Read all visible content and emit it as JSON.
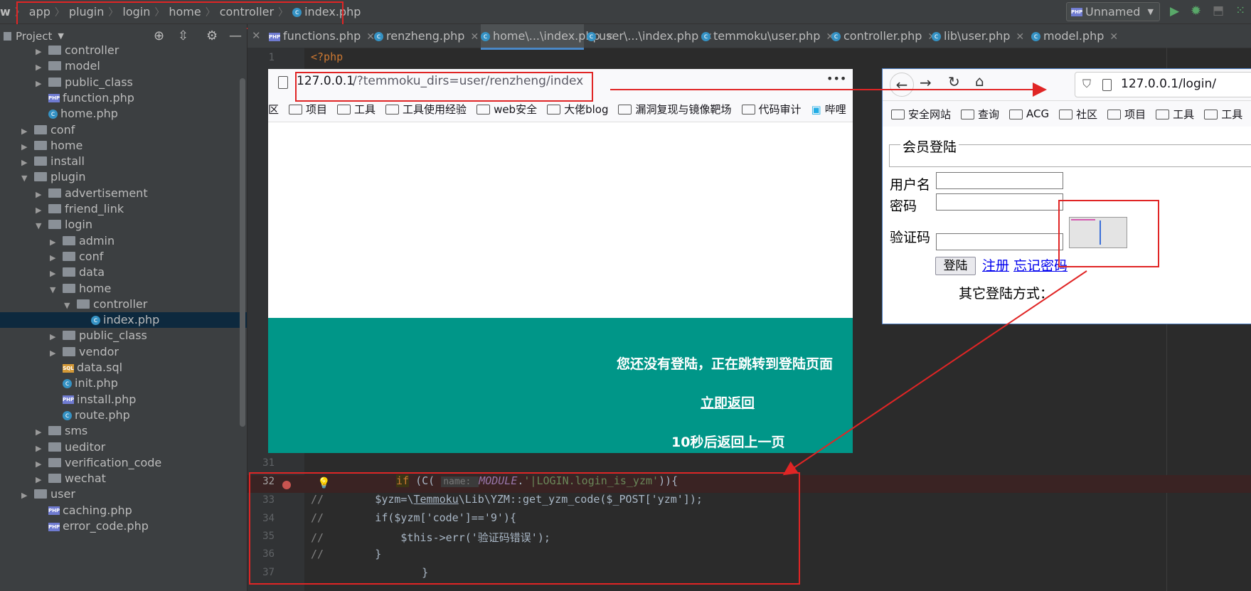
{
  "breadcrumb": {
    "prefix": "w",
    "items": [
      "app",
      "plugin",
      "login",
      "home",
      "controller"
    ],
    "file": "index.php"
  },
  "run_config": {
    "name": "Unnamed"
  },
  "project_panel": {
    "title": "Project"
  },
  "tree": [
    {
      "label": "controller",
      "type": "folder",
      "level": 2,
      "arrow": "▶"
    },
    {
      "label": "model",
      "type": "folder",
      "level": 2,
      "arrow": "▶"
    },
    {
      "label": "public_class",
      "type": "folder",
      "level": 2,
      "arrow": "▶"
    },
    {
      "label": "function.php",
      "type": "php",
      "level": 2,
      "arrow": ""
    },
    {
      "label": "home.php",
      "type": "class",
      "level": 2,
      "arrow": ""
    },
    {
      "label": "conf",
      "type": "folder",
      "level": 1,
      "arrow": "▶"
    },
    {
      "label": "home",
      "type": "folder",
      "level": 1,
      "arrow": "▶"
    },
    {
      "label": "install",
      "type": "folder",
      "level": 1,
      "arrow": "▶"
    },
    {
      "label": "plugin",
      "type": "folder",
      "level": 1,
      "arrow": "▼"
    },
    {
      "label": "advertisement",
      "type": "folder",
      "level": 2,
      "arrow": "▶"
    },
    {
      "label": "friend_link",
      "type": "folder",
      "level": 2,
      "arrow": "▶"
    },
    {
      "label": "login",
      "type": "folder",
      "level": 2,
      "arrow": "▼"
    },
    {
      "label": "admin",
      "type": "folder",
      "level": 3,
      "arrow": "▶"
    },
    {
      "label": "conf",
      "type": "folder",
      "level": 3,
      "arrow": "▶"
    },
    {
      "label": "data",
      "type": "folder",
      "level": 3,
      "arrow": "▶"
    },
    {
      "label": "home",
      "type": "folder",
      "level": 3,
      "arrow": "▼"
    },
    {
      "label": "controller",
      "type": "folder",
      "level": 4,
      "arrow": "▼"
    },
    {
      "label": "index.php",
      "type": "class",
      "level": 5,
      "arrow": "",
      "selected": true
    },
    {
      "label": "public_class",
      "type": "folder",
      "level": 3,
      "arrow": "▶"
    },
    {
      "label": "vendor",
      "type": "folder",
      "level": 3,
      "arrow": "▶"
    },
    {
      "label": "data.sql",
      "type": "sql",
      "level": 3,
      "arrow": ""
    },
    {
      "label": "init.php",
      "type": "class",
      "level": 3,
      "arrow": ""
    },
    {
      "label": "install.php",
      "type": "php",
      "level": 3,
      "arrow": ""
    },
    {
      "label": "route.php",
      "type": "class",
      "level": 3,
      "arrow": ""
    },
    {
      "label": "sms",
      "type": "folder",
      "level": 2,
      "arrow": "▶"
    },
    {
      "label": "ueditor",
      "type": "folder",
      "level": 2,
      "arrow": "▶"
    },
    {
      "label": "verification_code",
      "type": "folder",
      "level": 2,
      "arrow": "▶"
    },
    {
      "label": "wechat",
      "type": "folder",
      "level": 2,
      "arrow": "▶"
    },
    {
      "label": "user",
      "type": "folder",
      "level": 1,
      "arrow": "▶"
    },
    {
      "label": "caching.php",
      "type": "php",
      "level": 2,
      "arrow": ""
    },
    {
      "label": "error_code.php",
      "type": "php",
      "level": 2,
      "arrow": ""
    }
  ],
  "tabs": [
    {
      "label": "functions.php",
      "type": "php"
    },
    {
      "label": "renzheng.php",
      "type": "class"
    },
    {
      "label": "home\\...\\index.php",
      "type": "class",
      "active": true
    },
    {
      "label": "user\\...\\index.php",
      "type": "class"
    },
    {
      "label": "temmoku\\user.php",
      "type": "class"
    },
    {
      "label": "controller.php",
      "type": "class"
    },
    {
      "label": "lib\\user.php",
      "type": "class"
    },
    {
      "label": "model.php",
      "type": "class"
    }
  ],
  "editor": {
    "first_line": "<?php",
    "line_numbers": [
      "1",
      "31",
      "32",
      "33",
      "34",
      "35",
      "36",
      "37"
    ],
    "lines": [
      {
        "tokens": [
          [
            "kw",
            "if"
          ],
          [
            "t",
            " (C( "
          ],
          [
            "hint",
            "name: "
          ],
          [
            "mod",
            "MODULE"
          ],
          [
            "t",
            "."
          ],
          [
            "str",
            "'|LOGIN.login_is_yzm'"
          ],
          [
            "t",
            ")){"
          ]
        ]
      },
      {
        "tokens": [
          [
            "cm",
            "//"
          ],
          [
            "t",
            "        $yzm=\\"
          ],
          [
            "t",
            "Temmoku"
          ],
          [
            "t",
            "\\Lib\\YZM::get_yzm_code($_POST['yzm']);"
          ]
        ]
      },
      {
        "tokens": [
          [
            "cm",
            "//"
          ],
          [
            "t",
            "        if($yzm['code']=='9'){"
          ]
        ]
      },
      {
        "tokens": [
          [
            "cm",
            "//"
          ],
          [
            "t",
            "            $this->err('验证码错误');"
          ]
        ]
      },
      {
        "tokens": [
          [
            "cm",
            "//"
          ],
          [
            "t",
            "        }"
          ]
        ]
      },
      {
        "tokens": [
          [
            "t",
            "    }"
          ]
        ]
      }
    ]
  },
  "browser1": {
    "url_host": "127.0.0.1",
    "url_path": "/?temmoku_dirs=user/renzheng/index",
    "menu": "•••",
    "bookmarks": [
      "区",
      "项目",
      "工具",
      "工具使用经验",
      "web安全",
      "大佬blog",
      "漏洞复现与镜像靶场",
      "代码审计",
      "哔哩"
    ],
    "message": "您还没有登陆，正在跳转到登陆页面",
    "return_link": "立即返回",
    "countdown": "10秒后返回上一页"
  },
  "browser2": {
    "url": "127.0.0.1/login/",
    "bookmarks": [
      "安全网站",
      "查询",
      "ACG",
      "社区",
      "项目",
      "工具",
      "工具"
    ],
    "legend": "会员登陆",
    "username_label": "用户名",
    "password_label": "密码",
    "captcha_label": "验证码",
    "login_button": "登陆",
    "register_link": "注册",
    "forgot_link": "忘记密码",
    "other_login": "其它登陆方式："
  },
  "colors": {
    "annotation_red": "#e02525",
    "teal": "#009688",
    "ide_bg": "#2b2b2b",
    "panel_bg": "#3c3f41"
  }
}
